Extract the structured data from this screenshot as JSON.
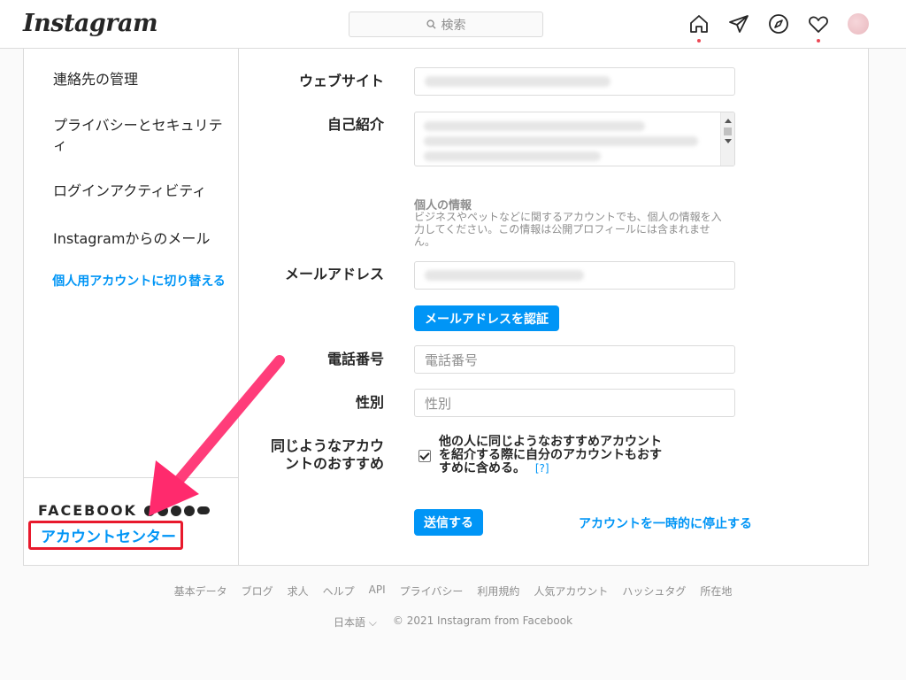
{
  "header": {
    "logo": "Instagram",
    "search_placeholder": "検索"
  },
  "sidebar": {
    "items": [
      {
        "label": "連絡先の管理"
      },
      {
        "label": "プライバシーとセキュリティ"
      },
      {
        "label": "ログインアクティビティ"
      },
      {
        "label": "Instagramからのメール"
      }
    ],
    "switch_label": "個人用アカウントに切り替える",
    "facebook_label": "FACEBOOK",
    "account_center": "アカウントセンター"
  },
  "form": {
    "website_label": "ウェブサイト",
    "bio_label": "自己紹介",
    "personal_info_title": "個人の情報",
    "personal_info_text": "ビジネスやペットなどに関するアカウントでも、個人の情報を入力してください。この情報は公開プロフィールには含まれません。",
    "email_label": "メールアドレス",
    "verify_email_button": "メールアドレスを認証",
    "phone_label": "電話番号",
    "phone_placeholder": "電話番号",
    "gender_label": "性別",
    "gender_placeholder": "性別",
    "suggest_label": "同じようなアカウントのおすすめ",
    "suggest_text": "他の人に同じようなおすすめアカウントを紹介する際に自分のアカウントもおすすめに含める。",
    "help_link": "[?]",
    "submit_button": "送信する",
    "deactivate_link": "アカウントを一時的に停止する"
  },
  "footer": {
    "links": [
      "基本データ",
      "ブログ",
      "求人",
      "ヘルプ",
      "API",
      "プライバシー",
      "利用規約",
      "人気アカウント",
      "ハッシュタグ",
      "所在地"
    ],
    "language": "日本語",
    "copyright": "© 2021 Instagram from Facebook"
  },
  "colors": {
    "accent": "#0095f6",
    "highlight": "#e8192c",
    "arrow": "#ff2a6d"
  }
}
